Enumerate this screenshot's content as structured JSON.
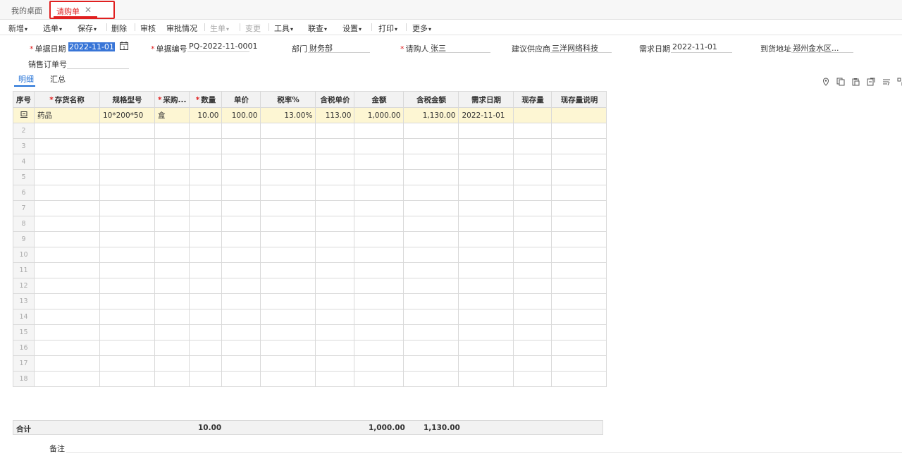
{
  "tabs": {
    "home": "我的桌面",
    "active": "请购单"
  },
  "toolbar": {
    "new": "新增",
    "select_doc": "选单",
    "save": "保存",
    "delete": "删除",
    "audit": "审核",
    "approval_status": "审批情况",
    "generate": "生单",
    "change": "变更",
    "tools": "工具",
    "linked_query": "联查",
    "settings": "设置",
    "print": "打印",
    "more": "更多"
  },
  "form": {
    "doc_date_label": "单据日期",
    "doc_date": "2022-11-01",
    "doc_no_label": "单据编号",
    "doc_no": "PQ-2022-11-0001",
    "dept_label": "部门",
    "dept": "财务部",
    "requester_label": "请购人",
    "requester": "张三",
    "supplier_label": "建议供应商",
    "supplier": "三洋网络科技",
    "need_date_label": "需求日期",
    "need_date": "2022-11-01",
    "address_label": "到货地址",
    "address": "郑州金水区...",
    "sales_order_label": "销售订单号",
    "sales_order": ""
  },
  "subtabs": {
    "detail": "明细",
    "summary": "汇总"
  },
  "grid": {
    "headers": [
      "序号",
      "存货名称",
      "规格型号",
      "采购...",
      "数量",
      "单价",
      "税率%",
      "含税单价",
      "金额",
      "含税金额",
      "需求日期",
      "现存量",
      "现存量说明"
    ],
    "row1": {
      "name": "药品",
      "spec": "10*200*50",
      "unit": "盒",
      "qty": "10.00",
      "price": "100.00",
      "tax_rate": "13.00%",
      "tax_price": "113.00",
      "amount": "1,000.00",
      "tax_amount": "1,130.00",
      "need_date": "2022-11-01",
      "stock": "",
      "stock_note": ""
    },
    "row_numbers": [
      "2",
      "3",
      "4",
      "5",
      "6",
      "7",
      "8",
      "9",
      "10",
      "11",
      "12",
      "13",
      "14",
      "15",
      "16",
      "17",
      "18"
    ]
  },
  "totals": {
    "label": "合计",
    "qty": "10.00",
    "amount": "1,000.00",
    "tax_amount": "1,130.00"
  },
  "remark_label": "备注",
  "colors": {
    "accent_red": "#e02020",
    "accent_blue": "#1f6fd6",
    "selected_row": "#fdf6d3"
  }
}
